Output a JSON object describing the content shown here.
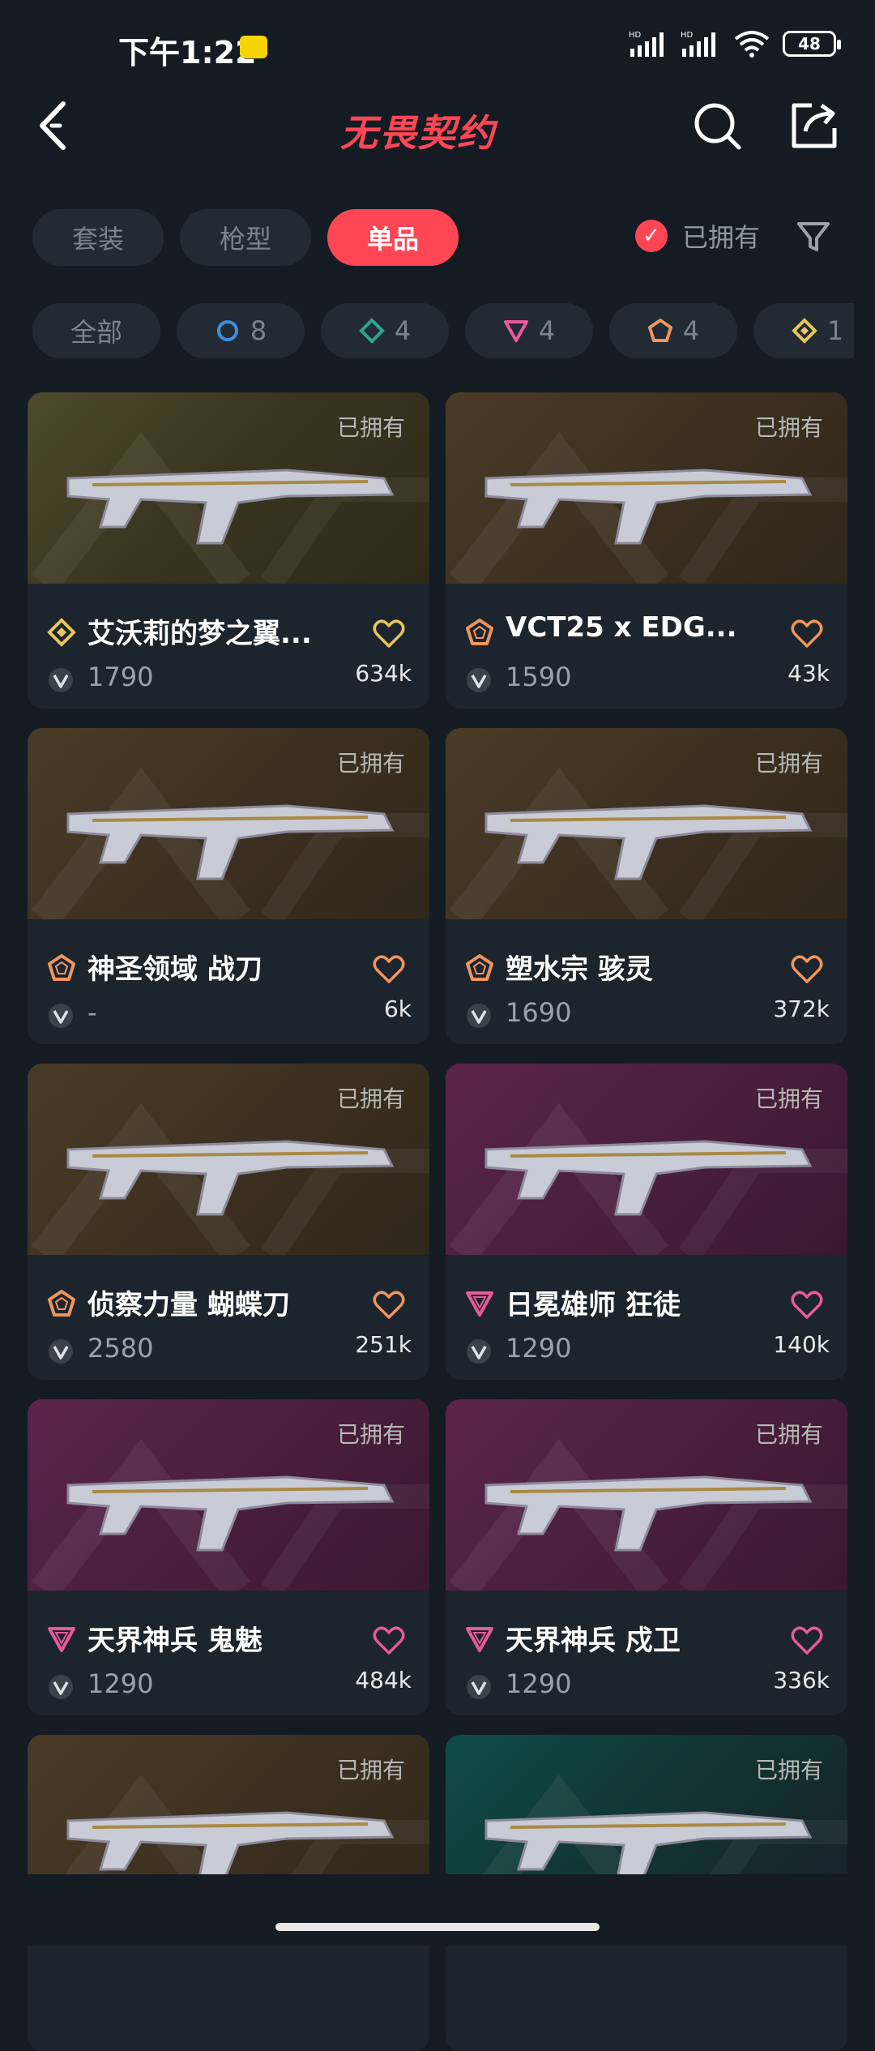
{
  "status": {
    "time": "下午1:22",
    "network_1": "HD",
    "network_2": "HD",
    "battery": "48"
  },
  "header": {
    "logo_text": "无畏契约"
  },
  "tabs": [
    {
      "label": "套装",
      "active": false
    },
    {
      "label": "枪型",
      "active": false
    },
    {
      "label": "单品",
      "active": true
    }
  ],
  "owned_filter": {
    "label": "已拥有",
    "checked": true
  },
  "chips": [
    {
      "label": "全部",
      "icon": ""
    },
    {
      "label": "8",
      "icon": "ring-blue"
    },
    {
      "label": "4",
      "icon": "diamond-teal"
    },
    {
      "label": "4",
      "icon": "triangle-pink"
    },
    {
      "label": "4",
      "icon": "pentagon-orange"
    },
    {
      "label": "1",
      "icon": "diamond-gold"
    }
  ],
  "owned_tag": "已拥有",
  "items": [
    {
      "name": "艾沃莉的梦之翼...",
      "price": "1790",
      "likes": "634k",
      "rarity": "gold",
      "bg": "gold"
    },
    {
      "name": "VCT25 x EDG...",
      "price": "1590",
      "likes": "43k",
      "rarity": "orange",
      "bg": "orange"
    },
    {
      "name": "神圣领域 战刀",
      "price": "-",
      "likes": "6k",
      "rarity": "orange",
      "bg": "orange"
    },
    {
      "name": "塑水宗 骇灵",
      "price": "1690",
      "likes": "372k",
      "rarity": "orange",
      "bg": "orange"
    },
    {
      "name": "侦察力量 蝴蝶刀",
      "price": "2580",
      "likes": "251k",
      "rarity": "orange",
      "bg": "orange"
    },
    {
      "name": "日冕雄师 狂徒",
      "price": "1290",
      "likes": "140k",
      "rarity": "pink",
      "bg": "purple"
    },
    {
      "name": "天界神兵 鬼魅",
      "price": "1290",
      "likes": "484k",
      "rarity": "pink",
      "bg": "purple"
    },
    {
      "name": "天界神兵 戍卫",
      "price": "1290",
      "likes": "336k",
      "rarity": "pink",
      "bg": "purple"
    },
    {
      "name": "",
      "price": "",
      "likes": "",
      "rarity": "",
      "bg": "orange"
    },
    {
      "name": "",
      "price": "",
      "likes": "",
      "rarity": "",
      "bg": "teal"
    }
  ],
  "colors": {
    "accent": "#ff4655",
    "gold": "#e8c65a",
    "orange": "#f0955a",
    "pink": "#e75a9a",
    "teal": "#2ea58e",
    "blue": "#3f8fe0"
  }
}
